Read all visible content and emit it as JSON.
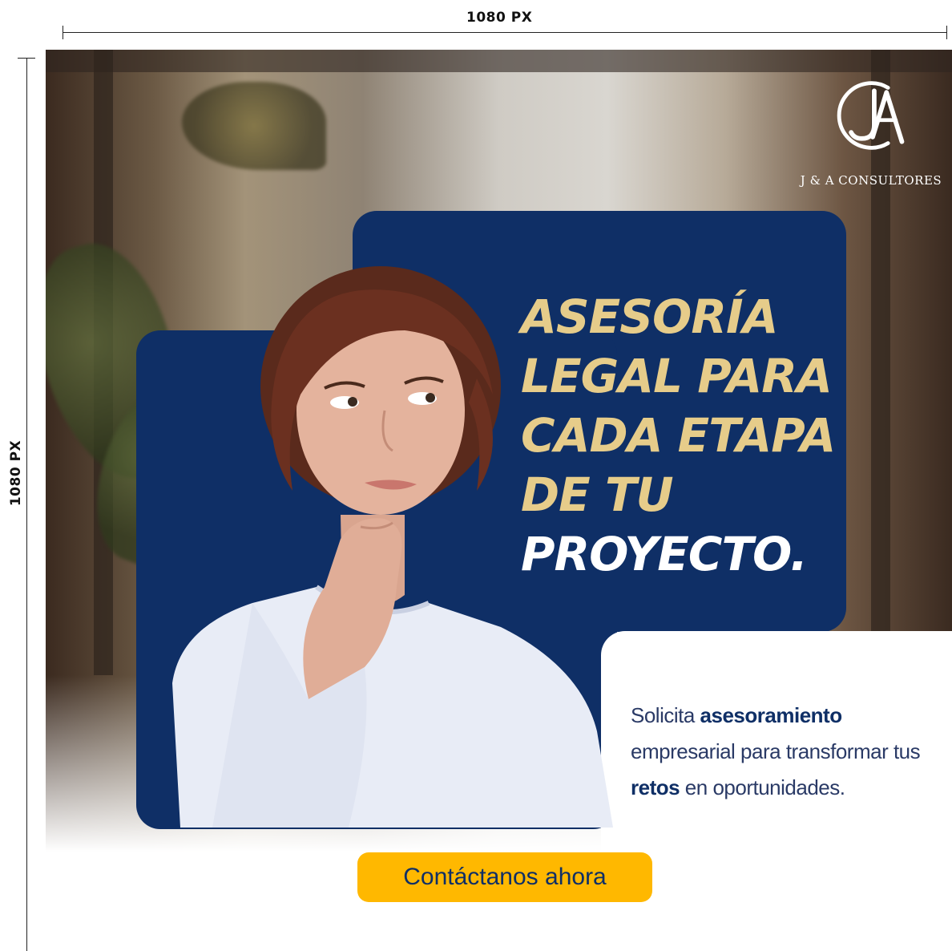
{
  "dimensions": {
    "width_label": "1080 PX",
    "height_label": "1080 PX"
  },
  "brand": {
    "name": "J & A CONSULTORES",
    "logo_letters": "JA"
  },
  "headline": {
    "line1": "ASESORÍA",
    "line2": "LEGAL PARA",
    "line3": "CADA ETAPA",
    "line4": "DE TU",
    "line5": "PROYECTO."
  },
  "body": {
    "part1": "Solicita ",
    "bold1": "asesoramiento",
    "part2": " empresarial para transformar tus ",
    "bold2": "retos",
    "part3": " en oportunidades."
  },
  "cta": {
    "label": "Contáctanos ahora"
  },
  "colors": {
    "navy": "#0f2f66",
    "gold": "#e6cc8a",
    "cta_yellow": "#ffb800"
  }
}
